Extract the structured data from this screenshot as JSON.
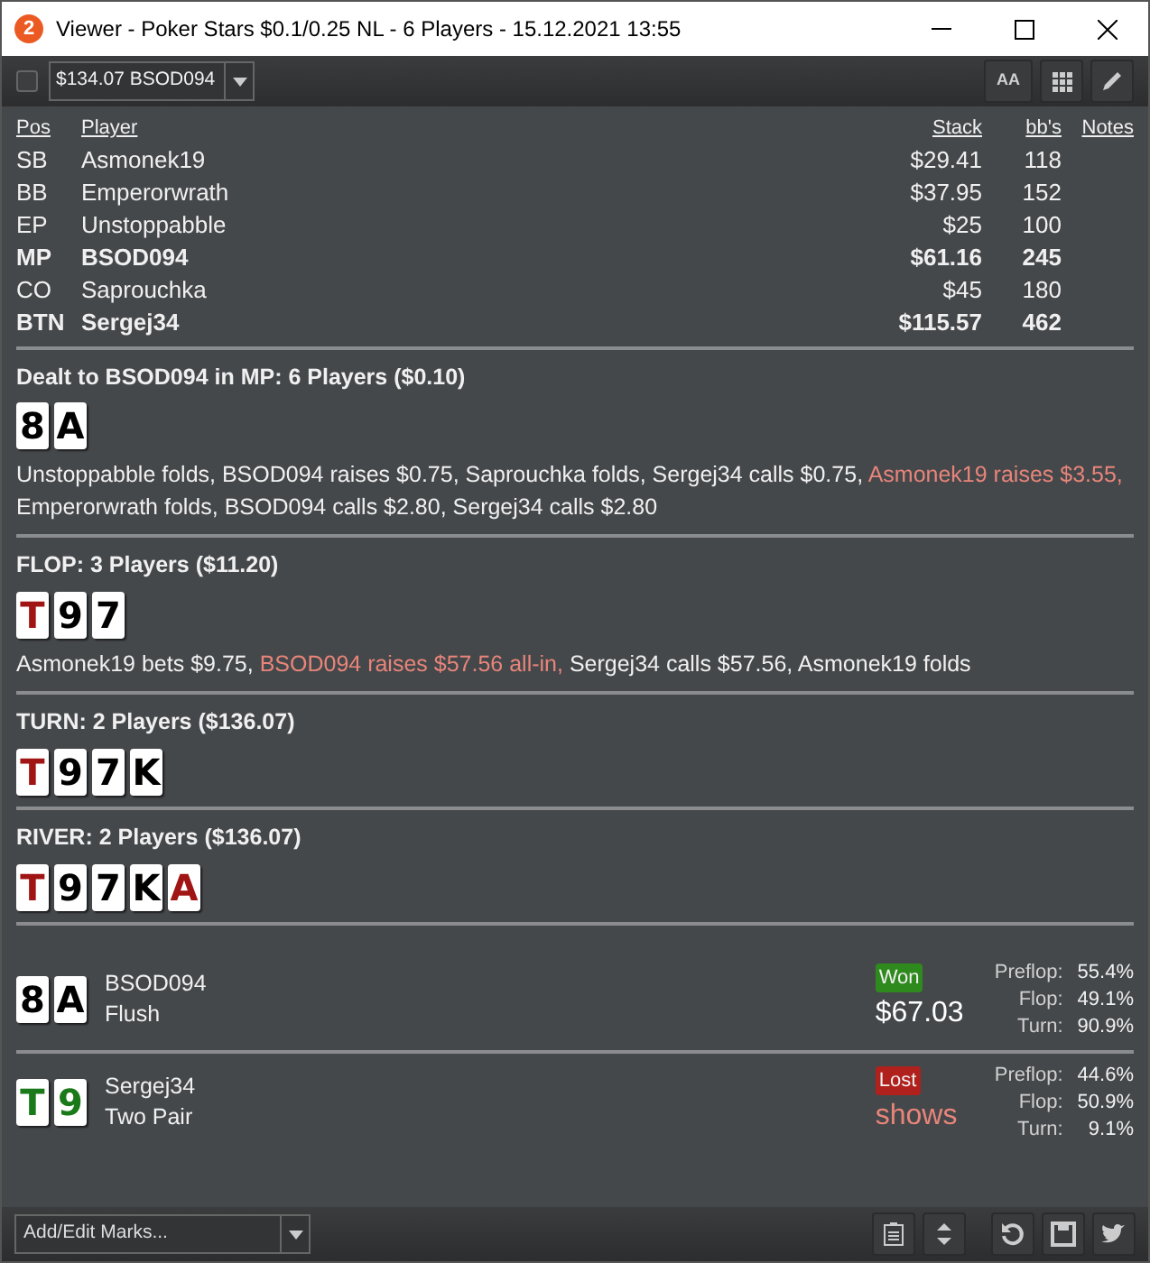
{
  "window": {
    "logo": "2",
    "title": "Viewer - Poker Stars $0.1/0.25 NL - 6 Players - 15.12.2021 13:55"
  },
  "toolbar": {
    "checked": false,
    "hand_select": "$134.07 BSOD094",
    "font_button": "AA"
  },
  "players": {
    "columns": [
      "Pos",
      "Player",
      "Stack",
      "bb's",
      "Notes"
    ],
    "rows": [
      {
        "pos": "SB",
        "player": "Asmonek19",
        "stack": "$29.41",
        "bbs": "118",
        "hero": false
      },
      {
        "pos": "BB",
        "player": "Emperorwrath",
        "stack": "$37.95",
        "bbs": "152",
        "hero": false
      },
      {
        "pos": "EP",
        "player": "Unstoppabble",
        "stack": "$25",
        "bbs": "100",
        "hero": false
      },
      {
        "pos": "MP",
        "player": "BSOD094",
        "stack": "$61.16",
        "bbs": "245",
        "hero": true
      },
      {
        "pos": "CO",
        "player": "Saprouchka",
        "stack": "$45",
        "bbs": "180",
        "hero": false
      },
      {
        "pos": "BTN",
        "player": "Sergej34",
        "stack": "$115.57",
        "bbs": "462",
        "hero": true
      }
    ]
  },
  "streets": [
    {
      "title": "Dealt to BSOD094 in MP: 6 Players ($0.10)",
      "cards": [
        {
          "rank": "8",
          "color": "#000000"
        },
        {
          "rank": "A",
          "color": "#000000"
        }
      ],
      "actions": [
        {
          "text": "Unstoppabble folds, BSOD094 raises $0.75, Saprouchka folds, Sergej34 calls $0.75, ",
          "aggressive": false
        },
        {
          "text": "Asmonek19 raises $3.55,",
          "aggressive": true
        },
        {
          "text": " Emperorwrath folds, BSOD094 calls $2.80, Sergej34 calls $2.80",
          "aggressive": false
        }
      ]
    },
    {
      "title": "FLOP: 3 Players ($11.20)",
      "cards": [
        {
          "rank": "T",
          "color": "#a01414"
        },
        {
          "rank": "9",
          "color": "#000000"
        },
        {
          "rank": "7",
          "color": "#000000"
        }
      ],
      "actions": [
        {
          "text": "Asmonek19 bets $9.75, ",
          "aggressive": false
        },
        {
          "text": "BSOD094 raises $57.56 all-in,",
          "aggressive": true
        },
        {
          "text": " Sergej34 calls $57.56, Asmonek19 folds",
          "aggressive": false
        }
      ]
    },
    {
      "title": "TURN: 2 Players ($136.07)",
      "cards": [
        {
          "rank": "T",
          "color": "#a01414"
        },
        {
          "rank": "9",
          "color": "#000000"
        },
        {
          "rank": "7",
          "color": "#000000"
        },
        {
          "rank": "K",
          "color": "#000000"
        }
      ]
    },
    {
      "title": "RIVER: 2 Players ($136.07)",
      "cards": [
        {
          "rank": "T",
          "color": "#a01414"
        },
        {
          "rank": "9",
          "color": "#000000"
        },
        {
          "rank": "7",
          "color": "#000000"
        },
        {
          "rank": "K",
          "color": "#000000"
        },
        {
          "rank": "A",
          "color": "#a01414"
        }
      ]
    }
  ],
  "showdown": [
    {
      "cards": [
        {
          "rank": "8",
          "color": "#000000"
        },
        {
          "rank": "A",
          "color": "#000000"
        }
      ],
      "player": "BSOD094",
      "hand": "Flush",
      "won": true,
      "badge": "Won",
      "amount": "$67.03",
      "equity": [
        {
          "label": "Preflop:",
          "value": "55.4%"
        },
        {
          "label": "Flop:",
          "value": "49.1%"
        },
        {
          "label": "Turn:",
          "value": "90.9%"
        }
      ]
    },
    {
      "cards": [
        {
          "rank": "T",
          "color": "#1a7a1a"
        },
        {
          "rank": "9",
          "color": "#1a7a1a"
        }
      ],
      "player": "Sergej34",
      "hand": "Two Pair",
      "won": false,
      "badge": "Lost",
      "amount": "shows",
      "equity": [
        {
          "label": "Preflop:",
          "value": "44.6%"
        },
        {
          "label": "Flop:",
          "value": "50.9%"
        },
        {
          "label": "Turn:",
          "value": "9.1%"
        }
      ]
    }
  ],
  "bottom_bar": {
    "marks_placeholder": "Add/Edit Marks..."
  }
}
